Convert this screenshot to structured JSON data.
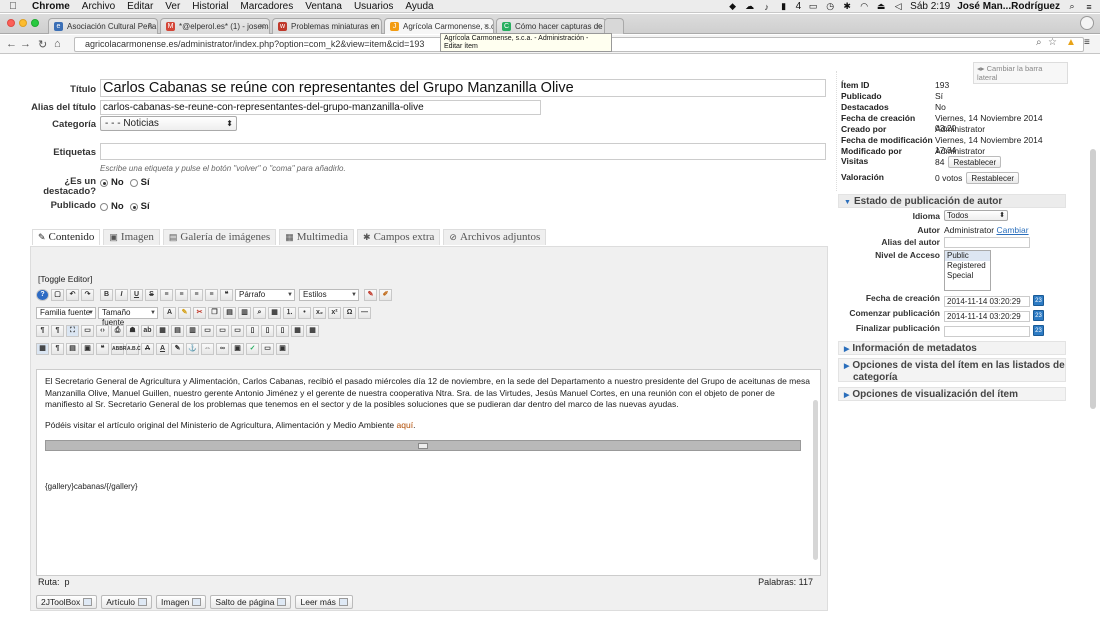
{
  "menubar": {
    "apple": "",
    "items": [
      "Chrome",
      "Archivo",
      "Editar",
      "Ver",
      "Historial",
      "Marcadores",
      "Ventana",
      "Usuarios",
      "Ayuda"
    ],
    "clock": "Sáb 2:19",
    "user": "José Man...Rodríguez",
    "battery_label": "4"
  },
  "tabs": [
    {
      "title": "Asociación Cultural Peña",
      "fav_color": "#3b6fb6",
      "fav": "e"
    },
    {
      "title": "*@elperol.es* (1) - joseman",
      "fav_color": "#d44638",
      "fav": "M"
    },
    {
      "title": "Problemas miniaturas en",
      "fav_color": "#c0392b",
      "fav": "w"
    },
    {
      "title": "Agrícola Carmonense, s.c.",
      "fav_color": "#f39c12",
      "fav": "J"
    },
    {
      "title": "Cómo hacer capturas de",
      "fav_color": "#27ae60",
      "fav": "C"
    }
  ],
  "address": {
    "url": "agricolacarmonense.es/administrator/index.php?option=com_k2&view=item&cid=193",
    "tooltip": "Agrícola Carmonense, s.c.a. - Administración - Editar ítem"
  },
  "form": {
    "title_label": "Título",
    "title_value": "Carlos Cabanas se reúne con representantes del Grupo Manzanilla Olive",
    "alias_label": "Alias del título",
    "alias_value": "carlos-cabanas-se-reune-con-representantes-del-grupo-manzanilla-olive",
    "category_label": "Categoría",
    "category_value": "- - - Noticias",
    "tags_label": "Etiquetas",
    "tags_hint": "Escribe una etiqueta y pulse el botón \"volver\" o \"coma\" para añadirlo.",
    "featured_label_1": "¿Es un",
    "featured_label_2": "destacado?",
    "published_label": "Publicado",
    "no": "No",
    "si": "Sí"
  },
  "content_tabs": [
    {
      "label": "Contenido",
      "icon": "pencil-icon",
      "glyph": "✎"
    },
    {
      "label": "Imagen",
      "icon": "image-icon",
      "glyph": "▣"
    },
    {
      "label": "Galería de imágenes",
      "icon": "gallery-icon",
      "glyph": "▤"
    },
    {
      "label": "Multimedia",
      "icon": "film-icon",
      "glyph": "▦"
    },
    {
      "label": "Campos extra",
      "icon": "wrench-icon",
      "glyph": "✱"
    },
    {
      "label": "Archivos adjuntos",
      "icon": "paperclip-icon",
      "glyph": "⊘"
    }
  ],
  "editor": {
    "toggle": "[Toggle Editor]",
    "format_select": "Párrafo",
    "styles_select": "Estilos",
    "font_family": "Familia fuente",
    "font_size": "Tamaño fuente",
    "paragraph1": "El Secretario General de Agricultura y Alimentación, Carlos Cabanas, recibió el pasado miércoles día 12 de noviembre, en la sede del Departamento a nuestro presidente del Grupo de aceitunas de mesa Manzanilla Olive, Manuel Guillen, nuestro gerente Antonio Jiménez y el gerente de nuestra cooperativa Ntra. Sra. de las Virtudes, Jesús Manuel Cortes, en una reunión con el objeto de poner de manifiesto al Sr. Secretario General de los problemas que tenemos en el sector y de la posibles soluciones que se pudieran dar dentro del marco de las nuevas ayudas.",
    "paragraph2_text": "Pódéis visitar el artículo original del Ministerio de Agricultura, Alimentación y Medio Ambiente",
    "paragraph2_link": "aquí",
    "paragraph2_end": ".",
    "gallery_code": "{gallery}cabanas/{/gallery}",
    "path_label": "Ruta:",
    "path_value": "p",
    "words": "Palabras: 117",
    "buttons": [
      "2JToolBox",
      "Artículo",
      "Imagen",
      "Salto de página",
      "Leer más"
    ]
  },
  "sidebar": {
    "toggle": "Cambiar la barra lateral",
    "info": [
      {
        "k": "Ítem ID",
        "v": "193"
      },
      {
        "k": "Publicado",
        "v": "Sí"
      },
      {
        "k": "Destacados",
        "v": "No"
      },
      {
        "k": "Fecha de creación",
        "v": "Viernes, 14 Noviembre 2014 03:20"
      },
      {
        "k": "Creado por",
        "v": "Administrator"
      },
      {
        "k": "Fecha de modificación",
        "v": "Viernes, 14 Noviembre 2014 17:34"
      },
      {
        "k": "Modificado por",
        "v": "Administrator"
      },
      {
        "k": "Visitas",
        "v": "84"
      },
      {
        "k": "Valoración",
        "v": "0 votos"
      }
    ],
    "reset_label": "Restablecer",
    "author_section": "Estado de publicación de autor",
    "idioma_label": "Idioma",
    "idioma_value": "Todos",
    "autor_label": "Autor",
    "autor_value": "Administrator",
    "cambiar": "Cambiar",
    "alias_autor_label": "Alias del autor",
    "nivel_label": "Nivel de Acceso",
    "nivel_options": [
      "Public",
      "Registered",
      "Special"
    ],
    "fecha_creacion_label": "Fecha de creación",
    "fecha_creacion_value": "2014-11-14 03:20:29",
    "comenzar_label": "Comenzar publicación",
    "comenzar_value": "2014-11-14 03:20:29",
    "finalizar_label": "Finalizar publicación",
    "sections": [
      "Información de metadatos",
      "Opciones de vista del ítem en las listados de categoría",
      "Opciones de visualización del ítem"
    ]
  }
}
